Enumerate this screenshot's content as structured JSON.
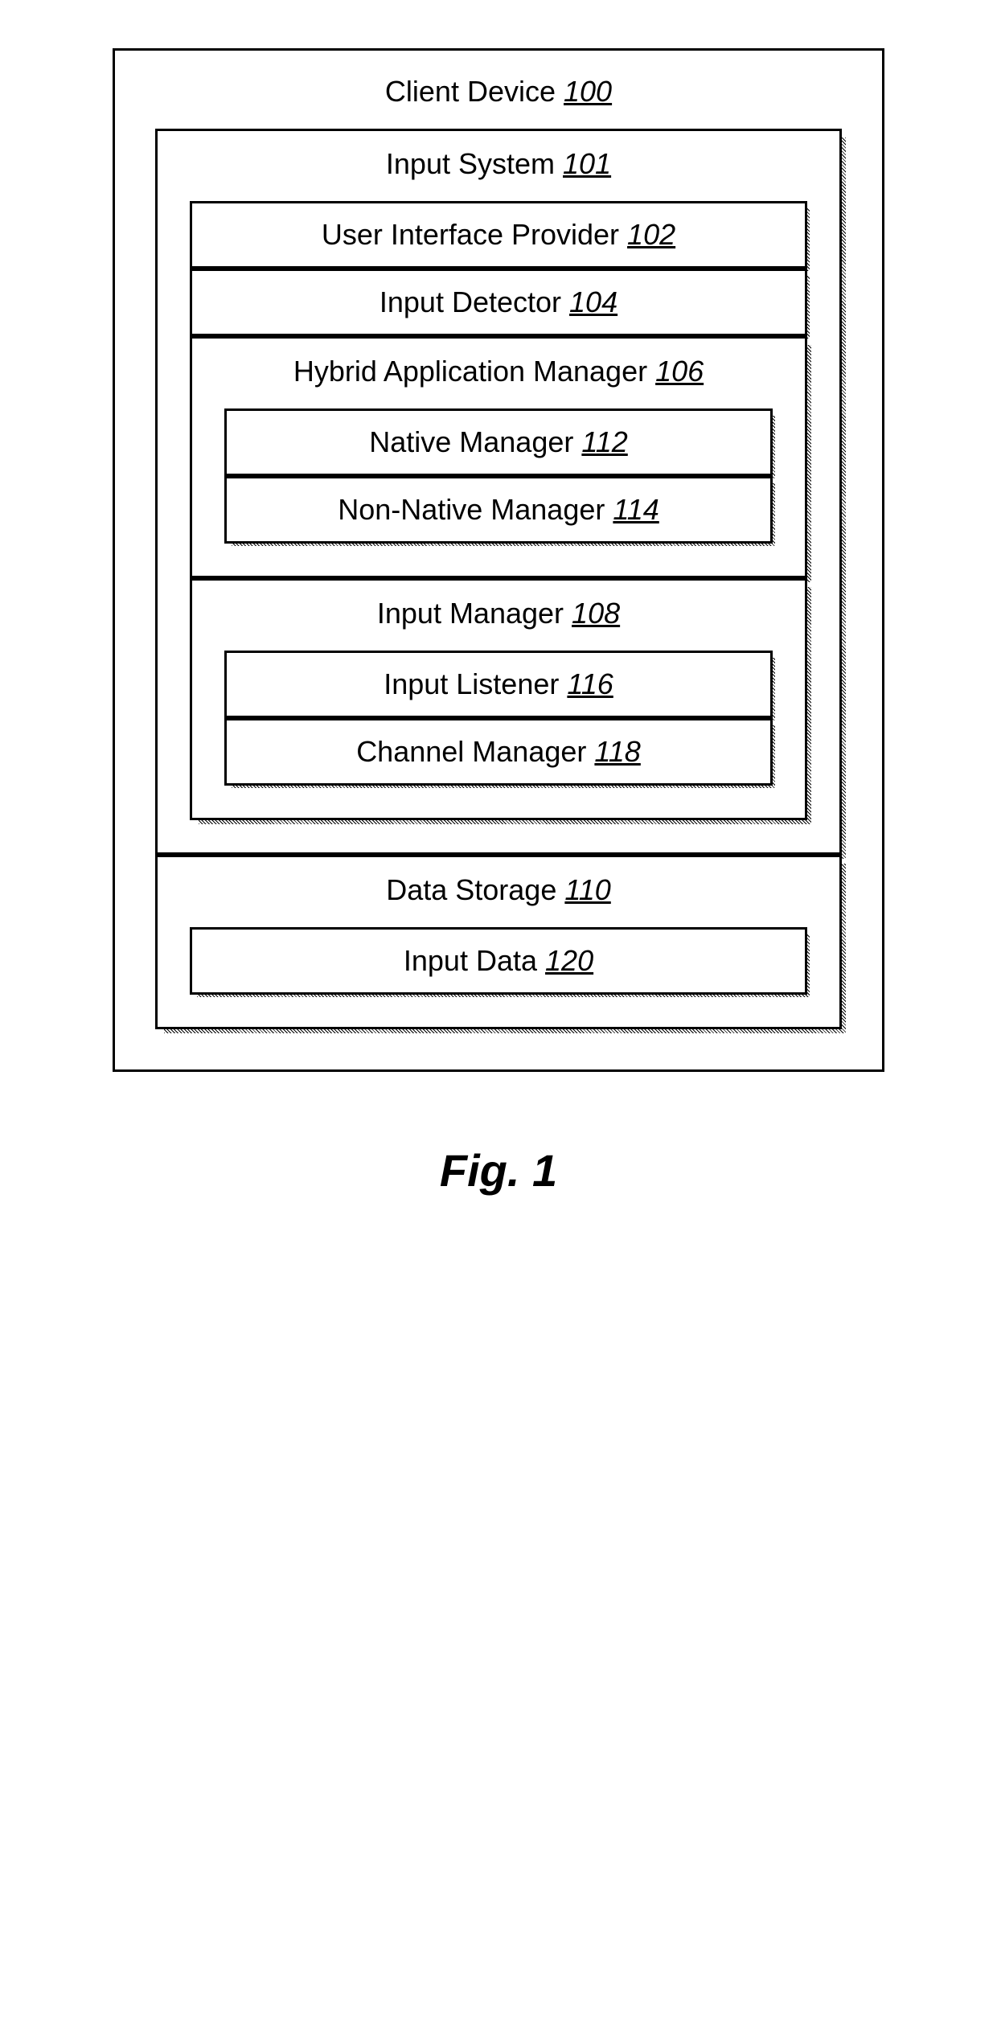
{
  "clientDevice": {
    "label": "Client Device",
    "ref": "100"
  },
  "inputSystem": {
    "label": "Input System",
    "ref": "101"
  },
  "uiProvider": {
    "label": "User Interface Provider",
    "ref": "102"
  },
  "inputDetector": {
    "label": "Input Detector",
    "ref": "104"
  },
  "hybridAppManager": {
    "label": "Hybrid Application Manager",
    "ref": "106"
  },
  "nativeManager": {
    "label": "Native Manager",
    "ref": "112"
  },
  "nonNativeManager": {
    "label": "Non-Native Manager",
    "ref": "114"
  },
  "inputManager": {
    "label": "Input Manager",
    "ref": "108"
  },
  "inputListener": {
    "label": "Input Listener",
    "ref": "116"
  },
  "channelManager": {
    "label": "Channel Manager",
    "ref": "118"
  },
  "dataStorage": {
    "label": "Data Storage",
    "ref": "110"
  },
  "inputData": {
    "label": "Input Data",
    "ref": "120"
  },
  "figureLabel": "Fig. 1"
}
